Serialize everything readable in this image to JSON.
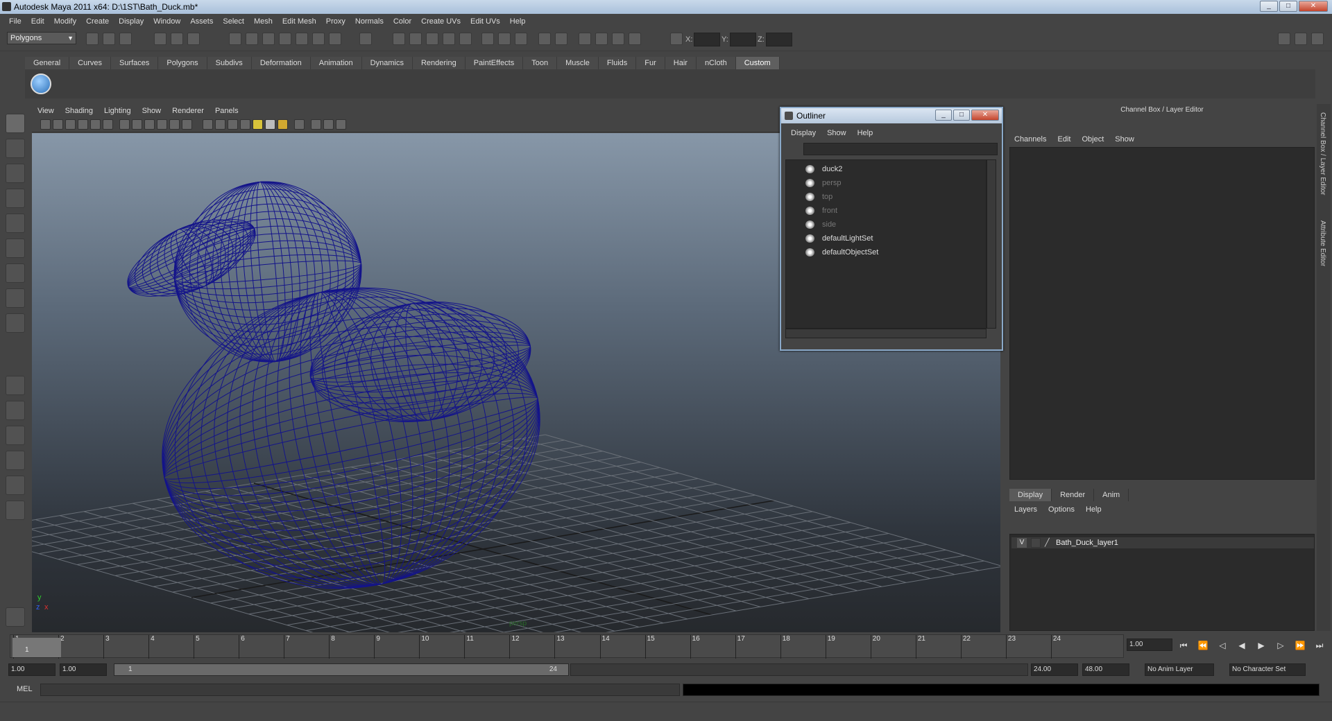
{
  "title": "Autodesk Maya 2011 x64: D:\\1ST\\Bath_Duck.mb*",
  "menubar": [
    "File",
    "Edit",
    "Modify",
    "Create",
    "Display",
    "Window",
    "Assets",
    "Select",
    "Mesh",
    "Edit Mesh",
    "Proxy",
    "Normals",
    "Color",
    "Create UVs",
    "Edit UVs",
    "Help"
  ],
  "toolbar": {
    "mode": "Polygons",
    "x_label": "X:",
    "y_label": "Y:",
    "z_label": "Z:"
  },
  "shelf_tabs": [
    "General",
    "Curves",
    "Surfaces",
    "Polygons",
    "Subdivs",
    "Deformation",
    "Animation",
    "Dynamics",
    "Rendering",
    "PaintEffects",
    "Toon",
    "Muscle",
    "Fluids",
    "Fur",
    "Hair",
    "nCloth",
    "Custom"
  ],
  "shelf_active": "Custom",
  "panel_menu": [
    "View",
    "Shading",
    "Lighting",
    "Show",
    "Renderer",
    "Panels"
  ],
  "viewport": {
    "axis_y": "y",
    "axis_x": "x",
    "axis_z": "z",
    "camera": "persp"
  },
  "outliner": {
    "title": "Outliner",
    "menu": [
      "Display",
      "Show",
      "Help"
    ],
    "items": [
      {
        "label": "duck2",
        "dim": false
      },
      {
        "label": "persp",
        "dim": true
      },
      {
        "label": "top",
        "dim": true
      },
      {
        "label": "front",
        "dim": true
      },
      {
        "label": "side",
        "dim": true
      },
      {
        "label": "defaultLightSet",
        "dim": false
      },
      {
        "label": "defaultObjectSet",
        "dim": false
      }
    ]
  },
  "channel_box": {
    "header": "Channel Box / Layer Editor",
    "menu": [
      "Channels",
      "Edit",
      "Object",
      "Show"
    ]
  },
  "side_tabs": [
    "Channel Box / Layer Editor",
    "Attribute Editor"
  ],
  "layer_editor": {
    "tabs": [
      "Display",
      "Render",
      "Anim"
    ],
    "active_tab": "Display",
    "menu": [
      "Layers",
      "Options",
      "Help"
    ],
    "layers": [
      {
        "visible": "V",
        "name": "Bath_Duck_layer1"
      }
    ]
  },
  "timeline": {
    "ticks": [
      "1",
      "2",
      "3",
      "4",
      "5",
      "6",
      "7",
      "8",
      "9",
      "10",
      "11",
      "12",
      "13",
      "14",
      "15",
      "16",
      "17",
      "18",
      "19",
      "20",
      "21",
      "22",
      "23",
      "24"
    ],
    "current_frame": "1",
    "current_field": "1.00"
  },
  "range": {
    "start": "1.00",
    "anim_start": "1.00",
    "slider_start": "1",
    "slider_end": "24",
    "anim_end": "24.00",
    "end": "48.00",
    "anim_layer": "No Anim Layer",
    "char_set": "No Character Set"
  },
  "cmdline": {
    "label": "MEL"
  },
  "colors": {
    "wire": "#14148a",
    "accent": "#8aa9c9"
  }
}
